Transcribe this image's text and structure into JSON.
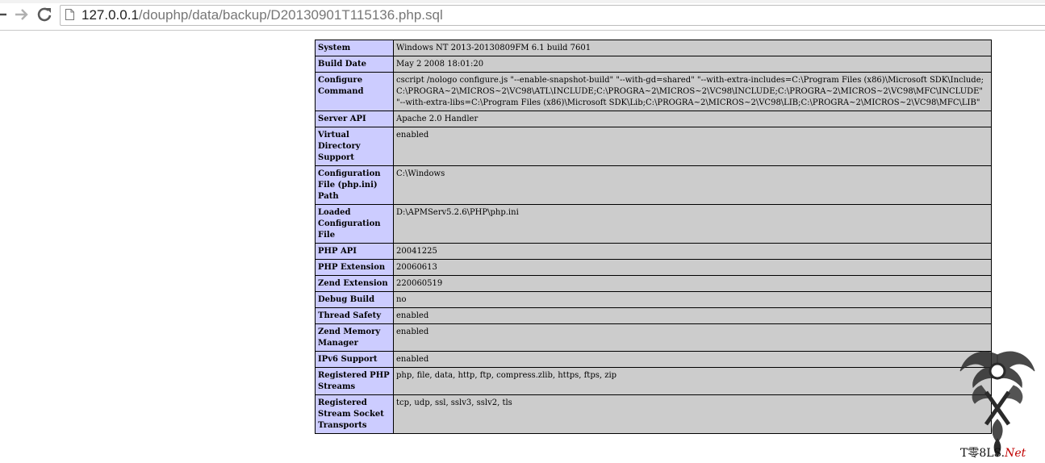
{
  "browser": {
    "url_host": "127.0.0.1",
    "url_path": "/douphp/data/backup/D20130901T115136.php.sql",
    "back_icon": "back-arrow-icon",
    "forward_icon": "forward-arrow-icon",
    "reload_icon": "reload-icon",
    "page_icon": "page-icon"
  },
  "rows": [
    {
      "key": "System",
      "value": "Windows NT 2013-20130809FM 6.1 build 7601"
    },
    {
      "key": "Build Date",
      "value": "May 2 2008 18:01:20"
    },
    {
      "key": "Configure Command",
      "value": "cscript /nologo configure.js \"--enable-snapshot-build\" \"--with-gd=shared\" \"--with-extra-includes=C:\\Program Files (x86)\\Microsoft SDK\\Include;C:\\PROGRA~2\\MICROS~2\\VC98\\ATL\\INCLUDE;C:\\PROGRA~2\\MICROS~2\\VC98\\INCLUDE;C:\\PROGRA~2\\MICROS~2\\VC98\\MFC\\INCLUDE\" \"--with-extra-libs=C:\\Program Files (x86)\\Microsoft SDK\\Lib;C:\\PROGRA~2\\MICROS~2\\VC98\\LIB;C:\\PROGRA~2\\MICROS~2\\VC98\\MFC\\LIB\""
    },
    {
      "key": "Server API",
      "value": "Apache 2.0 Handler"
    },
    {
      "key": "Virtual Directory Support",
      "value": "enabled"
    },
    {
      "key": "Configuration File (php.ini) Path",
      "value": "C:\\Windows"
    },
    {
      "key": "Loaded Configuration File",
      "value": "D:\\APMServ5.2.6\\PHP\\php.ini"
    },
    {
      "key": "PHP API",
      "value": "20041225"
    },
    {
      "key": "PHP Extension",
      "value": "20060613"
    },
    {
      "key": "Zend Extension",
      "value": "220060519"
    },
    {
      "key": "Debug Build",
      "value": "no"
    },
    {
      "key": "Thread Safety",
      "value": "enabled"
    },
    {
      "key": "Zend Memory Manager",
      "value": "enabled"
    },
    {
      "key": "IPv6 Support",
      "value": "enabled"
    },
    {
      "key": "Registered PHP Streams",
      "value": "php, file, data, http, ftp, compress.zlib, https, ftps, zip"
    },
    {
      "key": "Registered Stream Socket Transports",
      "value": "tcp, udp, ssl, sslv3, sslv2, tls"
    }
  ],
  "watermark": {
    "text_black": "T零8LS.",
    "text_red": "Net"
  },
  "colors": {
    "key_bg": "#ccccff",
    "value_bg": "#cccccc"
  }
}
